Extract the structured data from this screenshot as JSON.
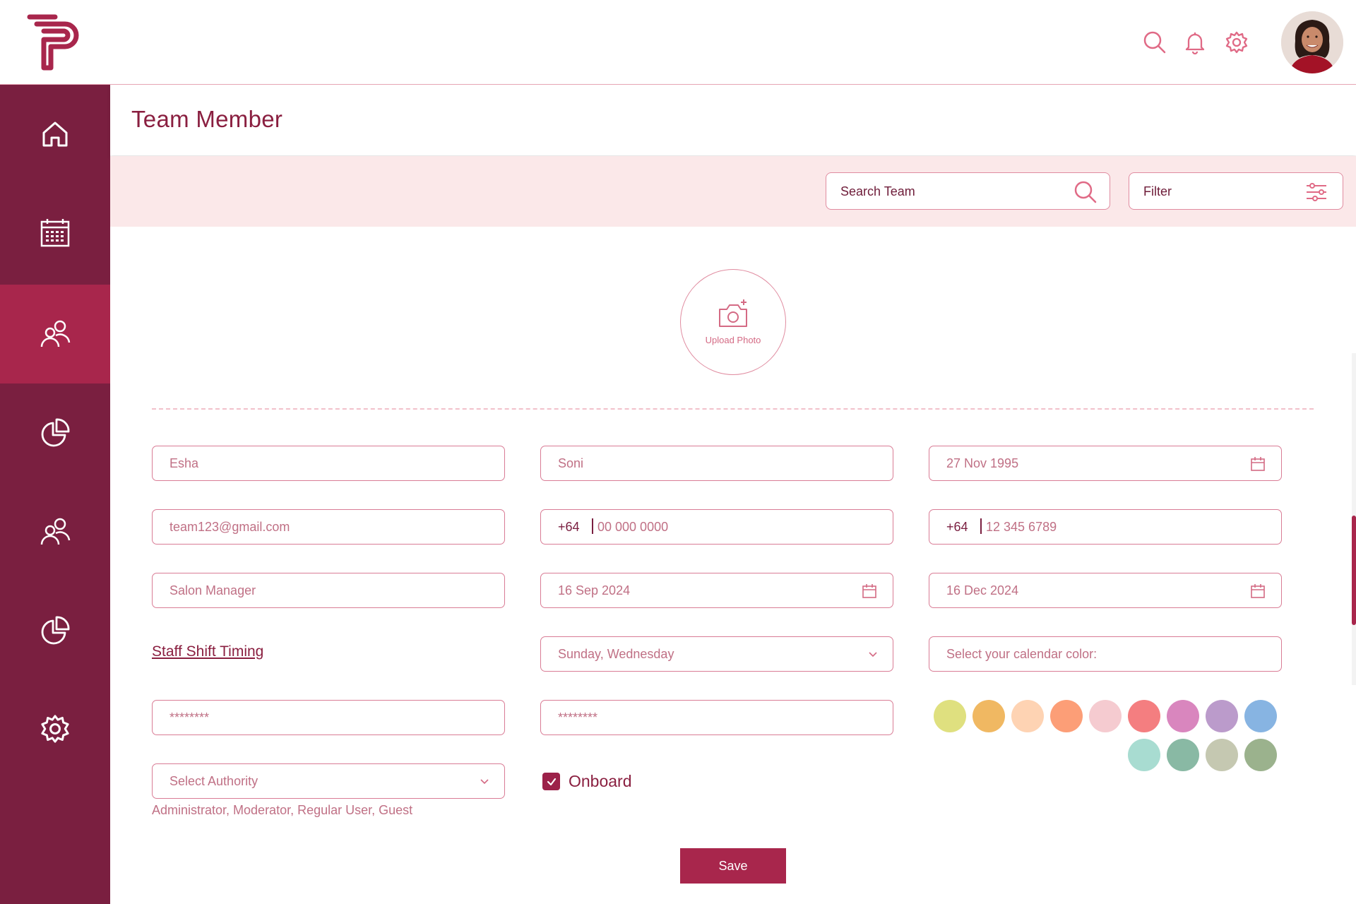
{
  "header": {
    "title": "Team Member"
  },
  "toolbar": {
    "search_label": "Search Team",
    "filter_label": "Filter"
  },
  "upload": {
    "label": "Upload Photo"
  },
  "form": {
    "first_name": "Esha",
    "last_name": "Soni",
    "dob": "27 Nov 1995",
    "email": "team123@gmail.com",
    "phone1_code": "+64",
    "phone1_number": "00 000 0000",
    "phone2_code": "+64",
    "phone2_number": "12 345 6789",
    "role": "Salon Manager",
    "start_date": "16 Sep 2024",
    "end_date": "16 Dec 2024",
    "shift_link": "Staff Shift Timing",
    "shift_days": "Sunday, Wednesday",
    "calendar_color_label": "Select your calendar color:",
    "password": "********",
    "confirm_password": "********",
    "authority_placeholder": "Select Authority",
    "authority_options": "Administrator, Moderator, Regular User, Guest",
    "onboard_label": "Onboard",
    "onboard_checked": true,
    "save_label": "Save"
  },
  "calendar_colors": [
    "#dfe07f",
    "#f0b862",
    "#fed3b3",
    "#fc9e77",
    "#f5cbd0",
    "#f47e80",
    "#d986be",
    "#bb9bcb",
    "#87b4e2",
    "#a8dcd1",
    "#89b9a4",
    "#c5c8b1",
    "#9bb28d"
  ],
  "sidebar": {
    "items": [
      "home",
      "calendar",
      "team",
      "reports",
      "clients",
      "analytics",
      "settings"
    ],
    "active": "team"
  },
  "colors": {
    "primary": "#7a1f40",
    "active": "#a8264c",
    "accent": "#e08ca0",
    "strip": "#fbe8e9"
  }
}
